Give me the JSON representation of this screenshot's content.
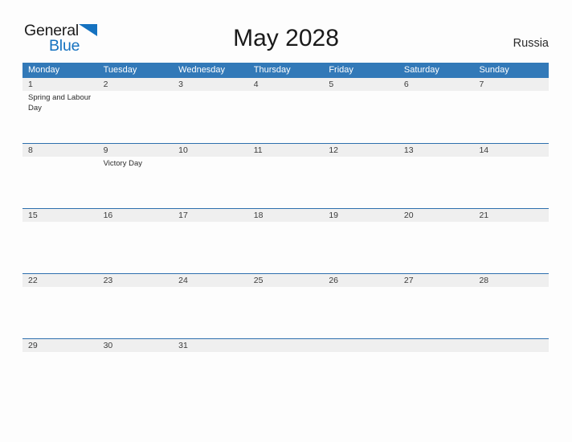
{
  "brand": {
    "name_top": "General",
    "name_bottom": "Blue",
    "flag_icon": "flag-triangle-icon",
    "top_color": "#1c1c1c",
    "bottom_color": "#1572c0"
  },
  "header": {
    "title": "May 2028",
    "country": "Russia"
  },
  "theme": {
    "header_blue": "#3279b8",
    "row_divider_blue": "#2e6fae",
    "date_band_gray": "#efefef",
    "page_background": "#fdfdfd"
  },
  "calendar": {
    "weekdays": [
      "Monday",
      "Tuesday",
      "Wednesday",
      "Thursday",
      "Friday",
      "Saturday",
      "Sunday"
    ],
    "weeks": [
      {
        "days": [
          {
            "number": "1",
            "events": [
              "Spring and Labour Day"
            ]
          },
          {
            "number": "2",
            "events": []
          },
          {
            "number": "3",
            "events": []
          },
          {
            "number": "4",
            "events": []
          },
          {
            "number": "5",
            "events": []
          },
          {
            "number": "6",
            "events": []
          },
          {
            "number": "7",
            "events": []
          }
        ]
      },
      {
        "days": [
          {
            "number": "8",
            "events": []
          },
          {
            "number": "9",
            "events": [
              "Victory Day"
            ]
          },
          {
            "number": "10",
            "events": []
          },
          {
            "number": "11",
            "events": []
          },
          {
            "number": "12",
            "events": []
          },
          {
            "number": "13",
            "events": []
          },
          {
            "number": "14",
            "events": []
          }
        ]
      },
      {
        "days": [
          {
            "number": "15",
            "events": []
          },
          {
            "number": "16",
            "events": []
          },
          {
            "number": "17",
            "events": []
          },
          {
            "number": "18",
            "events": []
          },
          {
            "number": "19",
            "events": []
          },
          {
            "number": "20",
            "events": []
          },
          {
            "number": "21",
            "events": []
          }
        ]
      },
      {
        "days": [
          {
            "number": "22",
            "events": []
          },
          {
            "number": "23",
            "events": []
          },
          {
            "number": "24",
            "events": []
          },
          {
            "number": "25",
            "events": []
          },
          {
            "number": "26",
            "events": []
          },
          {
            "number": "27",
            "events": []
          },
          {
            "number": "28",
            "events": []
          }
        ]
      },
      {
        "days": [
          {
            "number": "29",
            "events": []
          },
          {
            "number": "30",
            "events": []
          },
          {
            "number": "31",
            "events": []
          },
          {
            "number": "",
            "events": []
          },
          {
            "number": "",
            "events": []
          },
          {
            "number": "",
            "events": []
          },
          {
            "number": "",
            "events": []
          }
        ]
      }
    ]
  }
}
